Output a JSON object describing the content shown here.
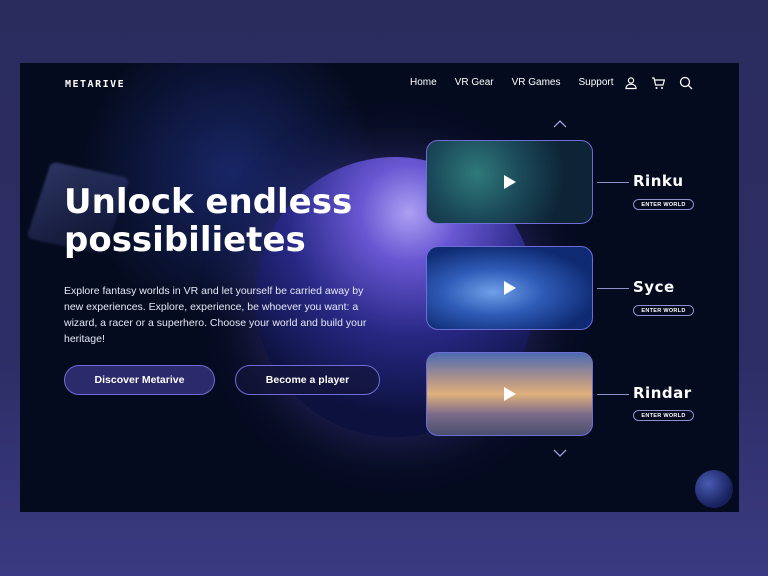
{
  "brand": {
    "logo": "METARIVE"
  },
  "nav": {
    "items": [
      "Home",
      "VR Gear",
      "VR Games",
      "Support"
    ]
  },
  "icons": {
    "account": "user-icon",
    "cart": "cart-icon",
    "search": "search-icon"
  },
  "hero": {
    "headline_line1": "Unlock endless",
    "headline_line2": "possibilietes",
    "description": "Explore fantasy worlds in VR and let yourself be carried away by new experiences. Explore, experience, be whoever you want: a wizard, a racer or a superhero. Choose your world and build your heritage!",
    "primary_button": "Discover Metarive",
    "secondary_button": "Become a player"
  },
  "worlds": [
    {
      "name": "Rinku",
      "cta": "ENTER WORLD"
    },
    {
      "name": "Syce",
      "cta": "ENTER WORLD"
    },
    {
      "name": "Rindar",
      "cta": "ENTER WORLD"
    }
  ],
  "colors": {
    "accent": "#6e6cd8",
    "background": "#050b1f",
    "page": "#2b2c5e"
  }
}
